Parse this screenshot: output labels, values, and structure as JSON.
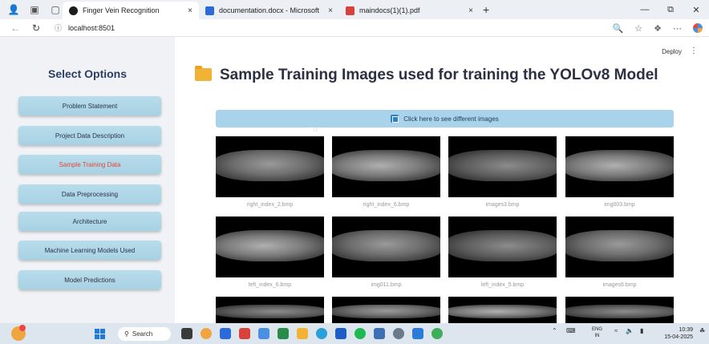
{
  "browser": {
    "tabs": [
      {
        "title": "Finger Vein Recognition",
        "close": "×",
        "active": true,
        "fav_color": "#1b1b1b"
      },
      {
        "title": "documentation.docx - Microsoft",
        "close": "×",
        "active": false,
        "fav_color": "#2b6ad8"
      },
      {
        "title": "maindocs(1)(1).pdf",
        "close": "×",
        "active": false,
        "fav_color": "#d9423a"
      }
    ],
    "new_tab": "+",
    "window_controls": [
      "—",
      "⧉",
      "✕"
    ],
    "url": "localhost:8501"
  },
  "app": {
    "deploy_label": "Deploy",
    "menu_icon": "⋮"
  },
  "sidebar": {
    "title": "Select Options",
    "items": [
      {
        "label": "Problem Statement",
        "active": false
      },
      {
        "label": "Project Data Description",
        "active": false
      },
      {
        "label": "Sample Training Data",
        "active": true
      },
      {
        "label": "Data Preprocessing",
        "active": false
      },
      {
        "label": "Architecture",
        "active": false
      },
      {
        "label": "Machine Learning Models Used",
        "active": false
      },
      {
        "label": "Model Predictions",
        "active": false
      }
    ]
  },
  "main": {
    "title": "Sample Training Images used for training the YOLOv8 Model",
    "expander_label": "Click here to see different images",
    "images": [
      {
        "caption": "right_index_2.bmp"
      },
      {
        "caption": "right_index_6.bmp"
      },
      {
        "caption": "images3.bmp"
      },
      {
        "caption": "img003.bmp"
      },
      {
        "caption": "left_index_6.bmp"
      },
      {
        "caption": "img011.bmp"
      },
      {
        "caption": "left_index_5.bmp"
      },
      {
        "caption": "images6.bmp"
      }
    ]
  },
  "taskbar": {
    "search_label": "Search",
    "lang_top": "ENG",
    "lang_bottom": "IN",
    "time": "10:39",
    "date": "15-04-2025"
  }
}
